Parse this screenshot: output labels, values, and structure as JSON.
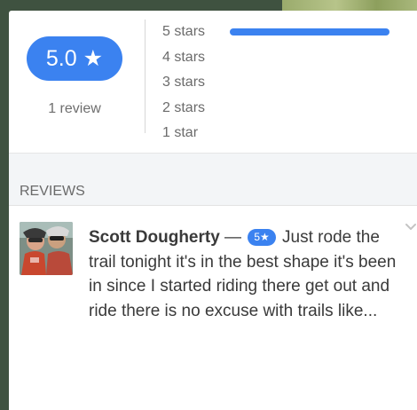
{
  "summary": {
    "score": "5.0",
    "score_icon": "star-icon",
    "review_count": "1 review",
    "distribution": [
      {
        "label": "5 stars",
        "fraction": 1.0
      },
      {
        "label": "4 stars",
        "fraction": 0.0
      },
      {
        "label": "3 stars",
        "fraction": 0.0
      },
      {
        "label": "2 stars",
        "fraction": 0.0
      },
      {
        "label": "1 star",
        "fraction": 0.0
      }
    ]
  },
  "reviews": {
    "header": "REVIEWS",
    "items": [
      {
        "author": "Scott Dougherty",
        "separator": " — ",
        "rating_badge": "5★",
        "text": " Just rode the trail tonight it's in the best shape it's been in since I started riding there get out and ride there is no excuse with trails like..."
      }
    ]
  },
  "colors": {
    "accent": "#3b82f0",
    "background": "#3f5240"
  }
}
